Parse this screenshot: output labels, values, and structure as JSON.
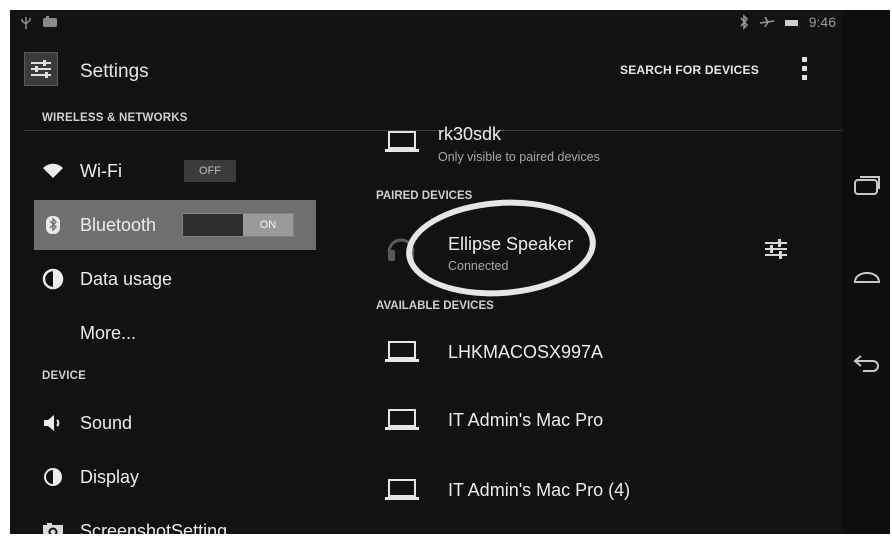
{
  "status_bar": {
    "time": "9:46",
    "left_icons": [
      "usb-icon",
      "notification-icon"
    ],
    "right_icons": [
      "bluetooth-icon",
      "airplane-mode-icon",
      "battery-icon"
    ]
  },
  "action_bar": {
    "title": "Settings",
    "search_label": "SEARCH FOR DEVICES",
    "overflow_icon": "overflow-menu-icon"
  },
  "sidebar": {
    "wireless_header": "WIRELESS & NETWORKS",
    "device_header": "DEVICE",
    "items": [
      {
        "label": "Wi-Fi",
        "icon": "wifi-icon",
        "toggle": "OFF"
      },
      {
        "label": "Bluetooth",
        "icon": "bluetooth-icon",
        "toggle": "ON",
        "selected": true
      },
      {
        "label": "Data usage",
        "icon": "data-usage-icon"
      },
      {
        "label": "More...",
        "icon": ""
      },
      {
        "label": "Sound",
        "icon": "speaker-icon"
      },
      {
        "label": "Display",
        "icon": "display-icon"
      },
      {
        "label": "ScreenshotSetting",
        "icon": "camera-icon"
      }
    ]
  },
  "bluetooth": {
    "this_device": {
      "name": "rk30sdk",
      "status": "Only visible to paired devices"
    },
    "paired_header": "PAIRED DEVICES",
    "paired": [
      {
        "name": "Ellipse Speaker",
        "status": "Connected",
        "icon": "headset-icon"
      }
    ],
    "available_header": "AVAILABLE DEVICES",
    "available": [
      {
        "name": "LHKMACOSX997A"
      },
      {
        "name": "IT Admin's Mac Pro"
      },
      {
        "name": "IT Admin's Mac Pro (4)"
      }
    ]
  },
  "nav_bar": [
    "recent-apps-icon",
    "home-icon",
    "back-icon"
  ],
  "colors": {
    "background": "#121212",
    "selected": "#6f6f6f",
    "text": "#ececec"
  }
}
